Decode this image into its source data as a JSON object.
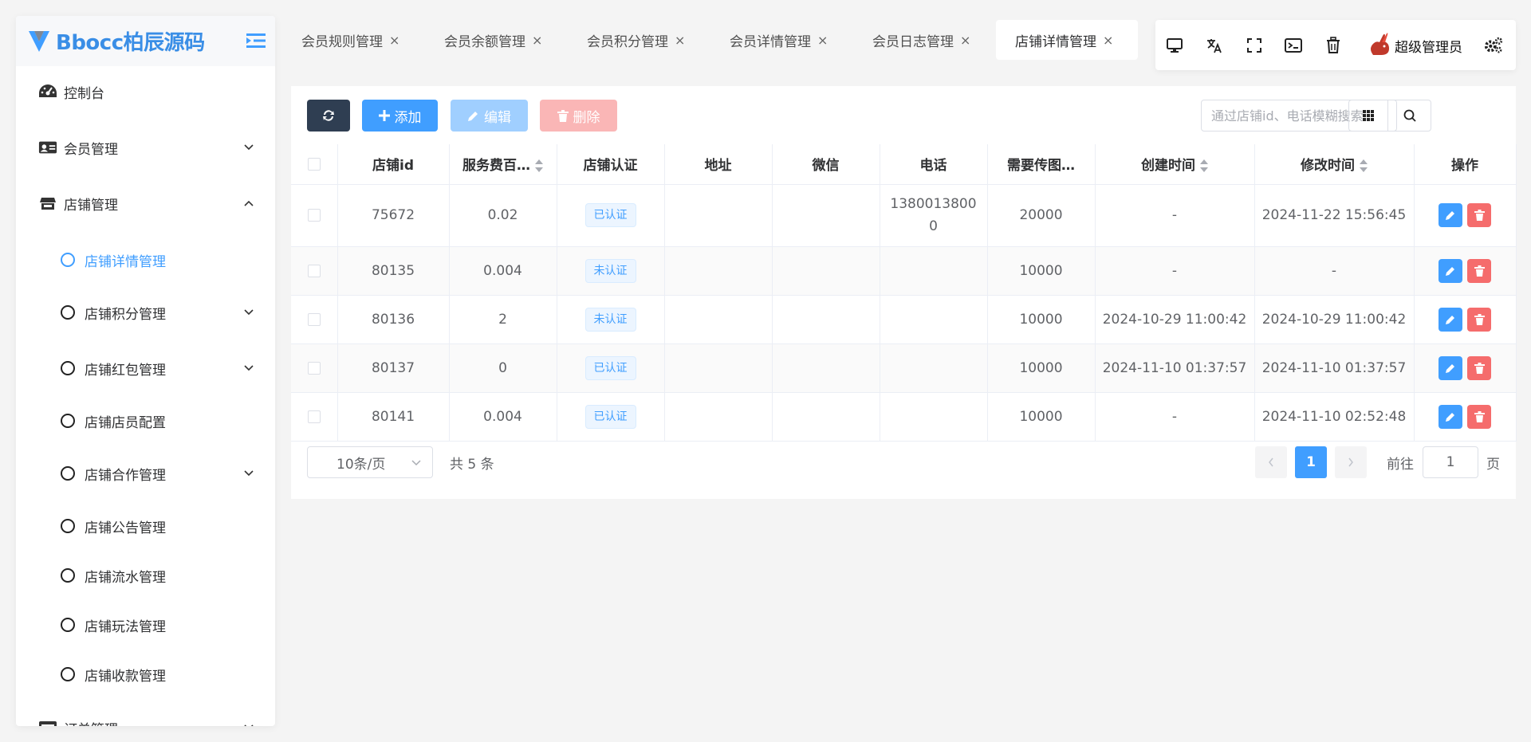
{
  "brand": {
    "name": "Bbocc柏辰源码"
  },
  "sidebar": {
    "items": [
      {
        "label": "控制台"
      },
      {
        "label": "会员管理"
      },
      {
        "label": "店铺管理"
      },
      {
        "label": "订单管理"
      }
    ],
    "sub_items": [
      {
        "label": "店铺详情管理"
      },
      {
        "label": "店铺积分管理"
      },
      {
        "label": "店铺红包管理"
      },
      {
        "label": "店铺店员配置"
      },
      {
        "label": "店铺合作管理"
      },
      {
        "label": "店铺公告管理"
      },
      {
        "label": "店铺流水管理"
      },
      {
        "label": "店铺玩法管理"
      },
      {
        "label": "店铺收款管理"
      }
    ]
  },
  "tabs": [
    {
      "label": "会员规则管理"
    },
    {
      "label": "会员余额管理"
    },
    {
      "label": "会员积分管理"
    },
    {
      "label": "会员详情管理"
    },
    {
      "label": "会员日志管理"
    },
    {
      "label": "店铺详情管理"
    }
  ],
  "tab_close": "×",
  "user": {
    "name": "超级管理员"
  },
  "toolbar": {
    "add_label": "添加",
    "edit_label": "编辑",
    "delete_label": "删除",
    "search_placeholder": "通过店铺id、电话模糊搜索"
  },
  "table": {
    "headers": [
      "店铺id",
      "服务费百…",
      "店铺认证",
      "地址",
      "微信",
      "电话",
      "需要传图…",
      "创建时间",
      "修改时间",
      "操作"
    ],
    "rows": [
      {
        "id": "75672",
        "fee": "0.02",
        "cert": "已认证",
        "address": "",
        "wechat": "",
        "phone_l1": "1380013800",
        "phone_l2": "0",
        "need": "20000",
        "created": "-",
        "modified": "2024-11-22 15:56:45"
      },
      {
        "id": "80135",
        "fee": "0.004",
        "cert": "未认证",
        "address": "",
        "wechat": "",
        "phone_l1": "",
        "phone_l2": "",
        "need": "10000",
        "created": "-",
        "modified": "-"
      },
      {
        "id": "80136",
        "fee": "2",
        "cert": "未认证",
        "address": "",
        "wechat": "",
        "phone_l1": "",
        "phone_l2": "",
        "need": "10000",
        "created": "2024-10-29 11:00:42",
        "modified": "2024-10-29 11:00:42"
      },
      {
        "id": "80137",
        "fee": "0",
        "cert": "已认证",
        "address": "",
        "wechat": "",
        "phone_l1": "",
        "phone_l2": "",
        "need": "10000",
        "created": "2024-11-10 01:37:57",
        "modified": "2024-11-10 01:37:57"
      },
      {
        "id": "80141",
        "fee": "0.004",
        "cert": "已认证",
        "address": "",
        "wechat": "",
        "phone_l1": "",
        "phone_l2": "",
        "need": "10000",
        "created": "-",
        "modified": "2024-11-10 02:52:48"
      }
    ]
  },
  "pagination": {
    "page_size": "10条/页",
    "total": "共 5 条",
    "current": "1",
    "goto_label": "前往",
    "goto_value": "1",
    "goto_suffix": "页"
  },
  "colors": {
    "primary": "#409eff",
    "danger": "#f56c6c",
    "dark": "#2f3e52"
  }
}
